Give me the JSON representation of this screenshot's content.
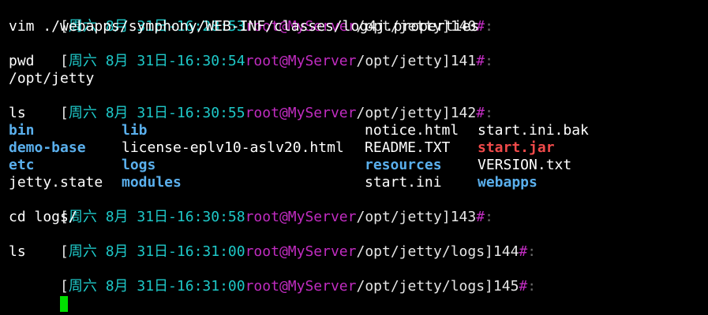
{
  "colors": {
    "background": "#000000",
    "datetime": "#1ec8c8",
    "user_host": "#c02cc0",
    "directory": "#5aafec",
    "executable": "#f04a4a",
    "cursor": "#00e000"
  },
  "prompts": [
    {
      "open": "[",
      "datetime": "周六 8月 31日-16:28:53",
      "user_host": "root@MyServer",
      "path": "/opt/jetty",
      "close": "]",
      "num": "140",
      "hash": "#",
      "colon": ":"
    },
    {
      "open": "[",
      "datetime": "周六 8月 31日-16:30:54",
      "user_host": "root@MyServer",
      "path": "/opt/jetty",
      "close": "]",
      "num": "141",
      "hash": "#",
      "colon": ":"
    },
    {
      "open": "[",
      "datetime": "周六 8月 31日-16:30:55",
      "user_host": "root@MyServer",
      "path": "/opt/jetty",
      "close": "]",
      "num": "142",
      "hash": "#",
      "colon": ":"
    },
    {
      "open": "[",
      "datetime": "周六 8月 31日-16:30:58",
      "user_host": "root@MyServer",
      "path": "/opt/jetty",
      "close": "]",
      "num": "143",
      "hash": "#",
      "colon": ":"
    },
    {
      "open": "[",
      "datetime": "周六 8月 31日-16:31:00",
      "user_host": "root@MyServer",
      "path": "/opt/jetty/logs",
      "close": "]",
      "num": "144",
      "hash": "#",
      "colon": ":"
    },
    {
      "open": "[",
      "datetime": "周六 8月 31日-16:31:00",
      "user_host": "root@MyServer",
      "path": "/opt/jetty/logs",
      "close": "]",
      "num": "145",
      "hash": "#",
      "colon": ":"
    }
  ],
  "commands": {
    "cmd_140": "vim ./webapps/symphony/WEB-INF/classes/log4j.properties",
    "cmd_141": "pwd",
    "out_141": "/opt/jetty",
    "cmd_142": "ls",
    "cmd_143": "cd logs/",
    "cmd_144": "ls"
  },
  "ls_listing": [
    [
      "bin",
      "lib",
      "notice.html",
      "start.ini.bak"
    ],
    [
      "demo-base",
      "license-eplv10-aslv20.html",
      "README.TXT",
      "start.jar"
    ],
    [
      "etc",
      "logs",
      "resources",
      "VERSION.txt"
    ],
    [
      "jetty.state",
      "modules",
      "start.ini",
      "webapps"
    ]
  ]
}
